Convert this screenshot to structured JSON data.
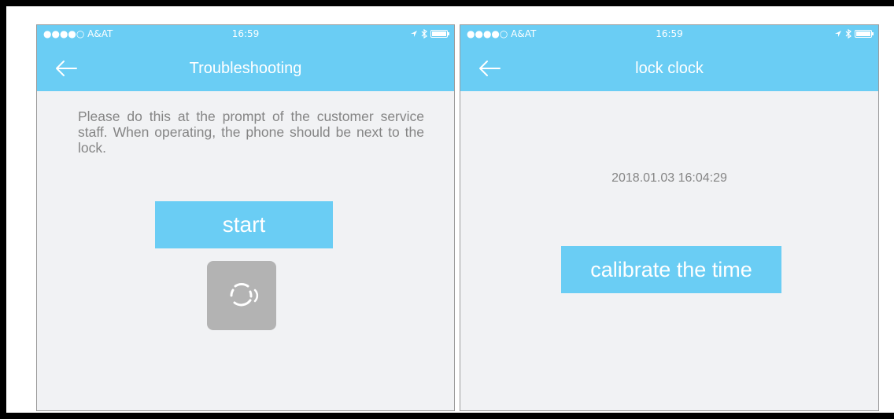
{
  "colors": {
    "accent": "#6acdf4",
    "unlock_bg": "#b3b3b3",
    "screen_bg": "#f1f2f4",
    "text_gray": "#858585"
  },
  "screens": [
    {
      "status": {
        "carrier": "●●●●○  A&AT",
        "time": "16:59"
      },
      "header": {
        "title": "Troubleshooting"
      },
      "body": {
        "instructions": "Please do this at the prompt of the customer service staff. When operating, the phone should be next to the lock.",
        "start_label": "start",
        "unlock_icon": "bluetooth-unlock-icon"
      }
    },
    {
      "status": {
        "carrier": "●●●●○  A&AT",
        "time": "16:59"
      },
      "header": {
        "title": "lock clock"
      },
      "body": {
        "datetime": "2018.01.03 16:04:29",
        "calibrate_label": "calibrate the time"
      }
    }
  ]
}
